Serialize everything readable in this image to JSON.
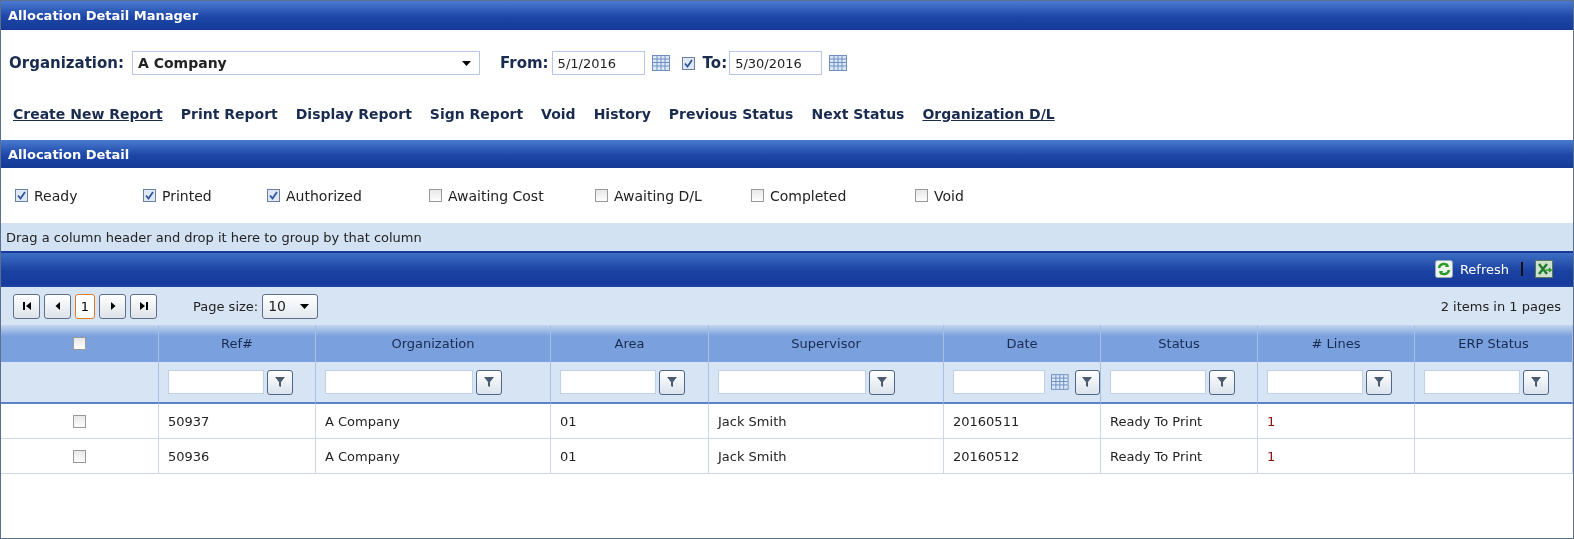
{
  "window": {
    "title": "Allocation Detail Manager"
  },
  "criteria": {
    "organization_label": "Organization:",
    "organization": "A Company",
    "from_label": "From:",
    "from": "5/1/2016",
    "to_enabled": true,
    "to_label": "To:",
    "to": "5/30/2016"
  },
  "actions": [
    {
      "label": "Create New Report",
      "underlined": true
    },
    {
      "label": "Print Report",
      "underlined": false
    },
    {
      "label": "Display Report",
      "underlined": false
    },
    {
      "label": "Sign Report",
      "underlined": false
    },
    {
      "label": "Void",
      "underlined": false
    },
    {
      "label": "History",
      "underlined": false
    },
    {
      "label": "Previous Status",
      "underlined": false
    },
    {
      "label": "Next Status",
      "underlined": false
    },
    {
      "label": "Organization D/L",
      "underlined": true
    }
  ],
  "section": {
    "title": "Allocation Detail"
  },
  "status_filters": [
    {
      "label": "Ready",
      "checked": true
    },
    {
      "label": "Printed",
      "checked": true
    },
    {
      "label": "Authorized",
      "checked": true
    },
    {
      "label": "Awaiting Cost",
      "checked": false
    },
    {
      "label": "Awaiting D/L",
      "checked": false
    },
    {
      "label": "Completed",
      "checked": false
    },
    {
      "label": "Void",
      "checked": false
    }
  ],
  "group_hint": "Drag a column header and drop it here to group by that column",
  "toolbar": {
    "refresh": "Refresh"
  },
  "pager": {
    "current_page": "1",
    "page_size_label": "Page size:",
    "page_size": "10",
    "summary": "2 items in 1 pages"
  },
  "table": {
    "select_all": {
      "checked": false
    },
    "columns": [
      {
        "label": "Ref#",
        "kind": "text"
      },
      {
        "label": "Organization",
        "kind": "text"
      },
      {
        "label": "Area",
        "kind": "text"
      },
      {
        "label": "Supervisor",
        "kind": "text"
      },
      {
        "label": "Date",
        "kind": "date"
      },
      {
        "label": "Status",
        "kind": "text"
      },
      {
        "label": "# Lines",
        "kind": "count"
      },
      {
        "label": "ERP Status",
        "kind": "text"
      }
    ],
    "rows": [
      {
        "checked": false,
        "cells": [
          "50937",
          "A Company",
          "01",
          "Jack Smith",
          "20160511",
          "Ready To Print",
          "1"
        ]
      },
      {
        "checked": false,
        "cells": [
          "50936",
          "A Company",
          "01",
          "Jack Smith",
          "20160512",
          "Ready To Print",
          "1"
        ]
      }
    ]
  }
}
